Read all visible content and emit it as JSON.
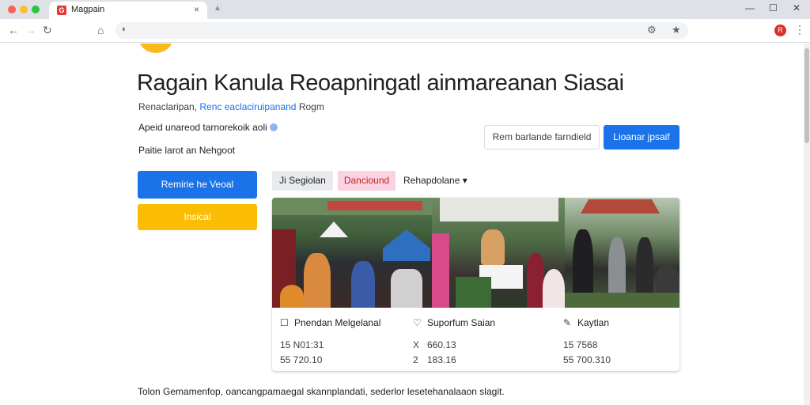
{
  "browser": {
    "tab_title": "Magpain",
    "tab_favicon": "G",
    "close_glyph": "×",
    "newtab_glyph": "▲",
    "win_min": "—",
    "win_max": "☐",
    "win_close": "✕",
    "back_glyph": "←",
    "forward_glyph": "→",
    "reload_glyph": "↻",
    "home_glyph": "⌂",
    "lock_glyph": "◐",
    "url": "",
    "extension_glyph": "⚙",
    "star_glyph": "★",
    "profile_initial": "R",
    "menu_glyph": "⋮"
  },
  "page": {
    "heading": "Ragain Kanula Reoapningatl ainmareanan Siasai",
    "breadcrumb_prefix": "Renaclaripan,",
    "breadcrumb_link": "Renc eaclaciruipanand",
    "breadcrumb_suffix": "Rogm",
    "subline": "Apeid unareod tarnorekoik aoli",
    "subline2": "Paitie larot an Nehgoot",
    "btn_outline": "Rem barlande farndield",
    "btn_blue_small": "Lioanar jpsaif",
    "btn_primary": "Remirie he Veoal",
    "btn_yellow": "Insical",
    "chip_gray": "Ji Segiolan",
    "chip_pink": "Danciound",
    "chip_dropdown": "Rehapdolane",
    "chip_dropdown_caret": "▾"
  },
  "card": {
    "columns": [
      {
        "icon": "☐",
        "title": "Pnendan Melgelanal",
        "row1": "15 N01:31",
        "row2": "55 720.10"
      },
      {
        "icon": "♡",
        "title": "Suporfum Saian",
        "row1_key": "X",
        "row1": "660.13",
        "row2_key": "2",
        "row2": "183.16"
      },
      {
        "icon": "✎",
        "title": "Kaytlan",
        "row1": "15 7568",
        "row2": "55 700.310"
      }
    ]
  },
  "footer": {
    "text": "Tolon Gemamenfop, oancangpamaegal skannplandati, sederlor lesetehanalaaon slagit."
  },
  "colors": {
    "accent_blue": "#1a73e8",
    "accent_yellow": "#fbbc04",
    "chip_pink": "#fad2e1",
    "logo_yellow": "#f9ba1b"
  }
}
